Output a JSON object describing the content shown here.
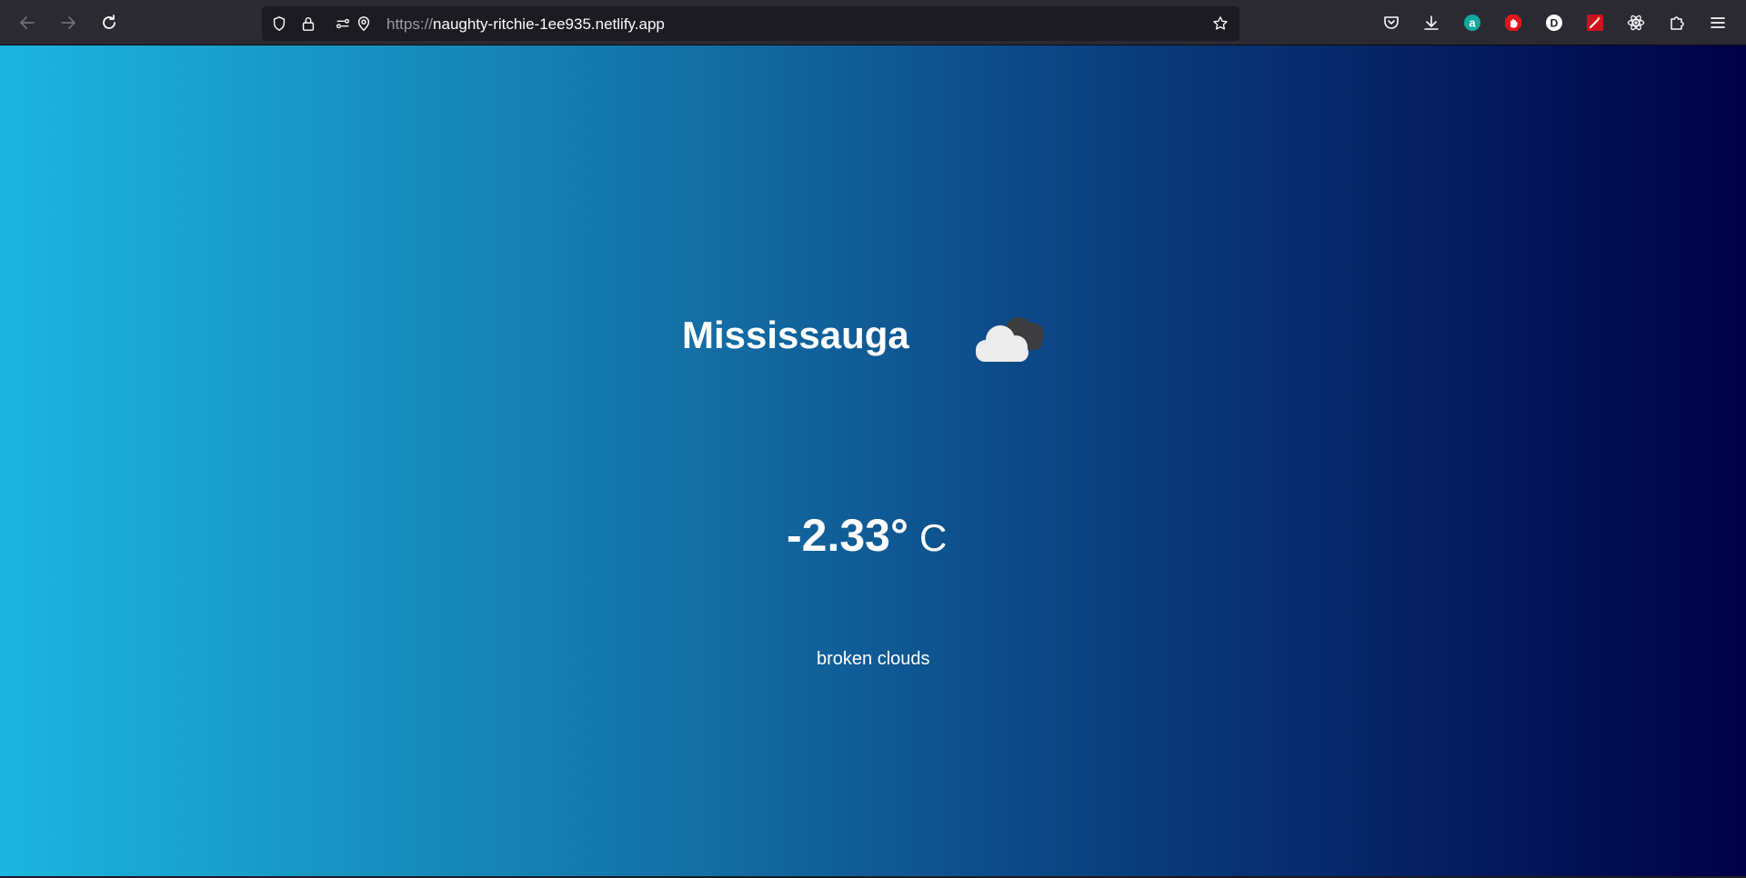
{
  "browser": {
    "url_scheme": "https://",
    "url_host": "naughty-ritchie-1ee935.netlify.app",
    "nav_icons": [
      "back-arrow-icon",
      "forward-arrow-icon",
      "reload-icon"
    ],
    "url_icons": [
      "shield-icon",
      "lock-icon",
      "permissions-icon",
      "location-icon",
      "star-icon"
    ],
    "toolbar_icons": [
      "pocket-icon",
      "download-icon",
      "amazon-assistant-icon",
      "adblock-icon",
      "dark-reader-icon",
      "magic-wand-icon",
      "react-devtools-icon",
      "extensions-icon",
      "menu-icon"
    ],
    "extension_letters": {
      "amazon": "a",
      "dark_reader": "D"
    }
  },
  "weather": {
    "city": "Mississauga",
    "icon": "broken-clouds-icon",
    "temperature": "-2.33°",
    "unit": "C",
    "description": "broken clouds"
  },
  "colors": {
    "gradient_start": "#1cb5e0",
    "gradient_end": "#000046",
    "toolbar_bg": "#2b2a33",
    "urlbar_bg": "#1c1b22"
  }
}
